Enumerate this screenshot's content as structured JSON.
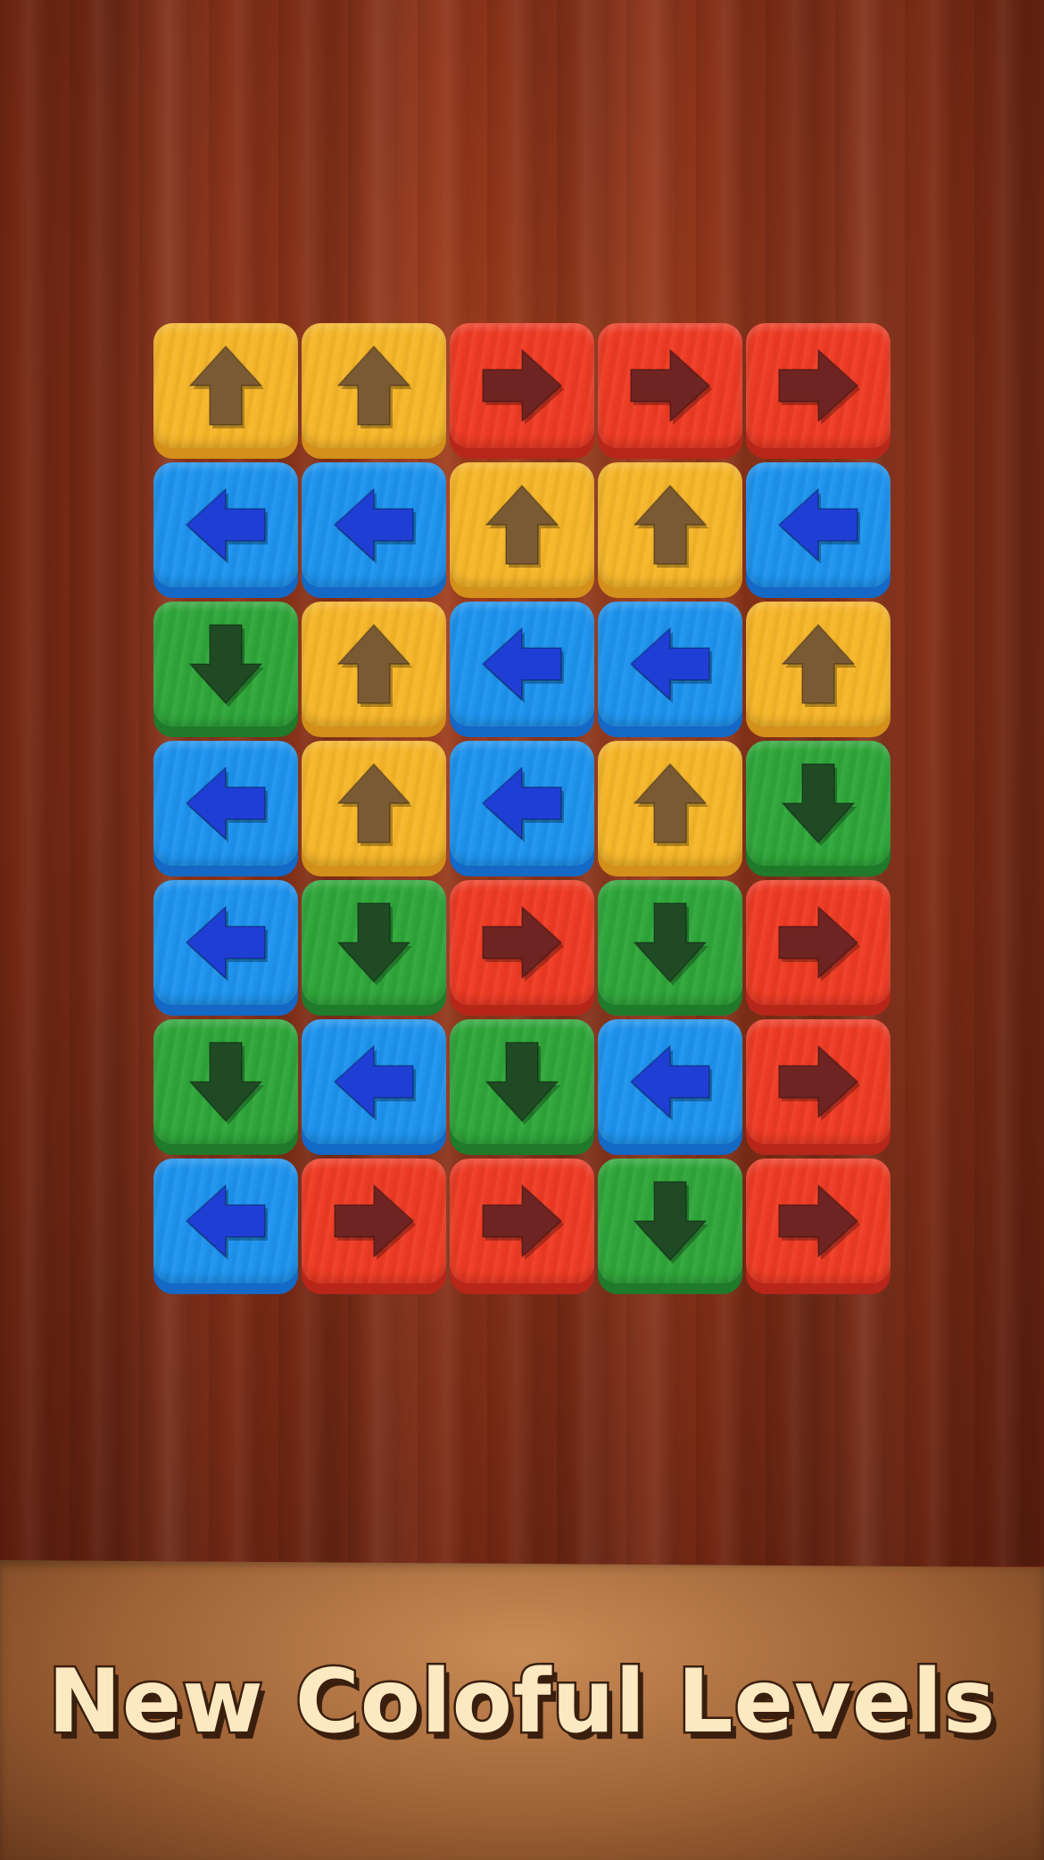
{
  "caption": "New Coloful Levels",
  "colors": {
    "yellow": {
      "face": "#f6b62a",
      "side": "#d3901a",
      "arrow": "#7a5a33"
    },
    "red": {
      "face": "#ee3b24",
      "side": "#b8261a",
      "arrow": "#6e2422"
    },
    "blue": {
      "face": "#1e93ee",
      "side": "#1468c6",
      "arrow": "#1f3fd4"
    },
    "green": {
      "face": "#2fa63a",
      "side": "#1f7a2a",
      "arrow": "#1f4a24"
    }
  },
  "grid": {
    "rows": 7,
    "cols": 5,
    "tiles": [
      [
        {
          "color": "yellow",
          "arrow": "up-arrow-icon"
        },
        {
          "color": "yellow",
          "arrow": "up-arrow-icon"
        },
        {
          "color": "red",
          "arrow": "right-arrow-icon"
        },
        {
          "color": "red",
          "arrow": "right-arrow-icon"
        },
        {
          "color": "red",
          "arrow": "right-arrow-icon"
        }
      ],
      [
        {
          "color": "blue",
          "arrow": "left-arrow-icon"
        },
        {
          "color": "blue",
          "arrow": "left-arrow-icon"
        },
        {
          "color": "yellow",
          "arrow": "up-arrow-icon"
        },
        {
          "color": "yellow",
          "arrow": "up-arrow-icon"
        },
        {
          "color": "blue",
          "arrow": "left-arrow-icon"
        }
      ],
      [
        {
          "color": "green",
          "arrow": "down-arrow-icon"
        },
        {
          "color": "yellow",
          "arrow": "up-arrow-icon"
        },
        {
          "color": "blue",
          "arrow": "left-arrow-icon"
        },
        {
          "color": "blue",
          "arrow": "left-arrow-icon"
        },
        {
          "color": "yellow",
          "arrow": "up-arrow-icon"
        }
      ],
      [
        {
          "color": "blue",
          "arrow": "left-arrow-icon"
        },
        {
          "color": "yellow",
          "arrow": "up-arrow-icon"
        },
        {
          "color": "blue",
          "arrow": "left-arrow-icon"
        },
        {
          "color": "yellow",
          "arrow": "up-arrow-icon"
        },
        {
          "color": "green",
          "arrow": "down-arrow-icon"
        }
      ],
      [
        {
          "color": "blue",
          "arrow": "left-arrow-icon"
        },
        {
          "color": "green",
          "arrow": "down-arrow-icon"
        },
        {
          "color": "red",
          "arrow": "right-arrow-icon"
        },
        {
          "color": "green",
          "arrow": "down-arrow-icon"
        },
        {
          "color": "red",
          "arrow": "right-arrow-icon"
        }
      ],
      [
        {
          "color": "green",
          "arrow": "down-arrow-icon"
        },
        {
          "color": "blue",
          "arrow": "left-arrow-icon"
        },
        {
          "color": "green",
          "arrow": "down-arrow-icon"
        },
        {
          "color": "blue",
          "arrow": "left-arrow-icon"
        },
        {
          "color": "red",
          "arrow": "right-arrow-icon"
        }
      ],
      [
        {
          "color": "blue",
          "arrow": "left-arrow-icon"
        },
        {
          "color": "red",
          "arrow": "right-arrow-icon"
        },
        {
          "color": "red",
          "arrow": "right-arrow-icon"
        },
        {
          "color": "green",
          "arrow": "down-arrow-icon"
        },
        {
          "color": "red",
          "arrow": "right-arrow-icon"
        }
      ]
    ]
  }
}
